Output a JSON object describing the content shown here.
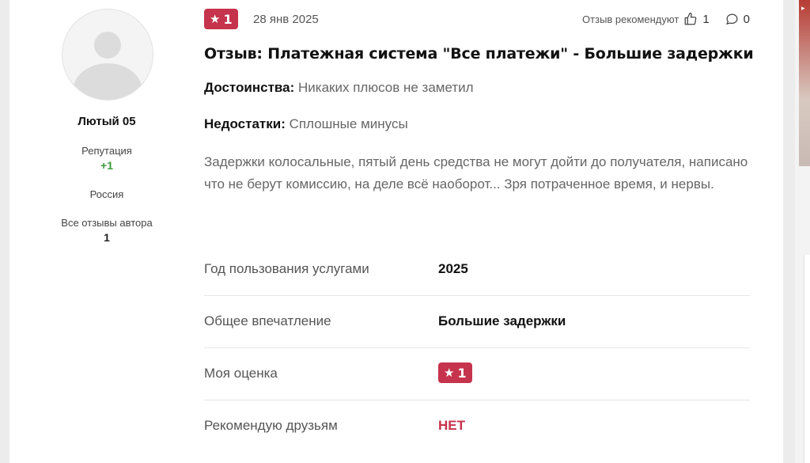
{
  "author": {
    "name": "Лютый 05",
    "reputation_label": "Репутация",
    "reputation_value": "+1",
    "country": "Россия",
    "all_reviews_label": "Все отзывы автора",
    "all_reviews_count": "1"
  },
  "review": {
    "rating": "1",
    "date": "28 янв 2025",
    "recommend_label": "Отзыв рекомендуют",
    "likes": "1",
    "comments": "0",
    "title": "Отзыв: Платежная система \"Все платежи\" - Большие задержки",
    "pros_label": "Достоинства:",
    "pros_text": "Никаких плюсов не заметил",
    "cons_label": "Недостатки:",
    "cons_text": "Сплошные минусы",
    "body": "Задержки колосальные, пятый день средства не могут дойти до получателя, написано что не берут комиссию, на деле всё наоборот... Зря потраченное время, и нервы."
  },
  "details": {
    "year_label": "Год пользования услугами",
    "year_value": "2025",
    "impression_label": "Общее впечатление",
    "impression_value": "Большие задержки",
    "my_rating_label": "Моя оценка",
    "my_rating_value": "1",
    "recommend_label": "Рекомендую друзьям",
    "recommend_value": "НЕТ"
  },
  "colors": {
    "accent": "#c6334c",
    "reputation": "#3a9a3a"
  },
  "icons": [
    "star-icon",
    "thumbs-up-icon",
    "comment-icon",
    "user-avatar-placeholder"
  ]
}
